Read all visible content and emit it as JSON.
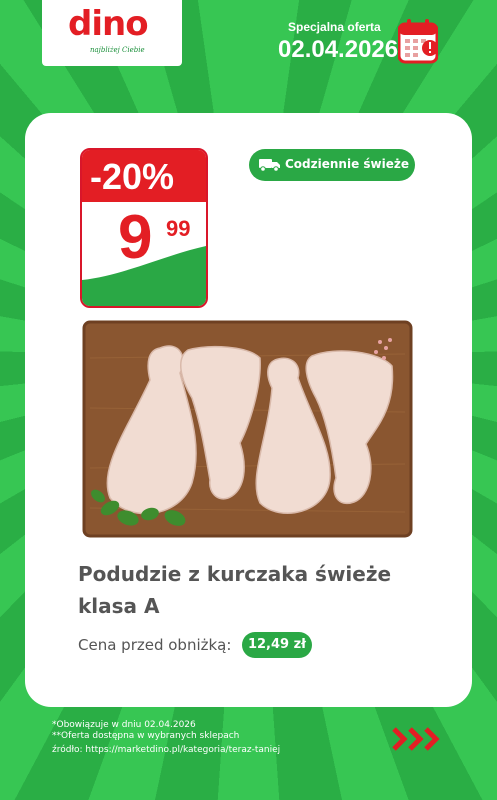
{
  "brand": {
    "logo_text": "dino",
    "tagline": "najbliżej Ciebie",
    "red": "#e31e24",
    "green": "#2aa845"
  },
  "offer": {
    "label": "Specjalna oferta",
    "date": "02.04.2026"
  },
  "price_tag": {
    "discount": "-20%",
    "price_int": "9",
    "price_dec": "99"
  },
  "badge": {
    "icon": "truck-icon",
    "label": "Codziennie świeże"
  },
  "product": {
    "name": "Podudzie z kurczaka świeże klasa A",
    "prev_label": "Cena przed obniżką:",
    "prev_price": "12,49 zł"
  },
  "footer": {
    "line1": "*Obowiązuje w dniu 02.04.2026",
    "line2": "**Oferta dostępna w wybranych sklepach",
    "line3": "źródło: https://marketdino.pl/kategoria/teraz-taniej"
  }
}
